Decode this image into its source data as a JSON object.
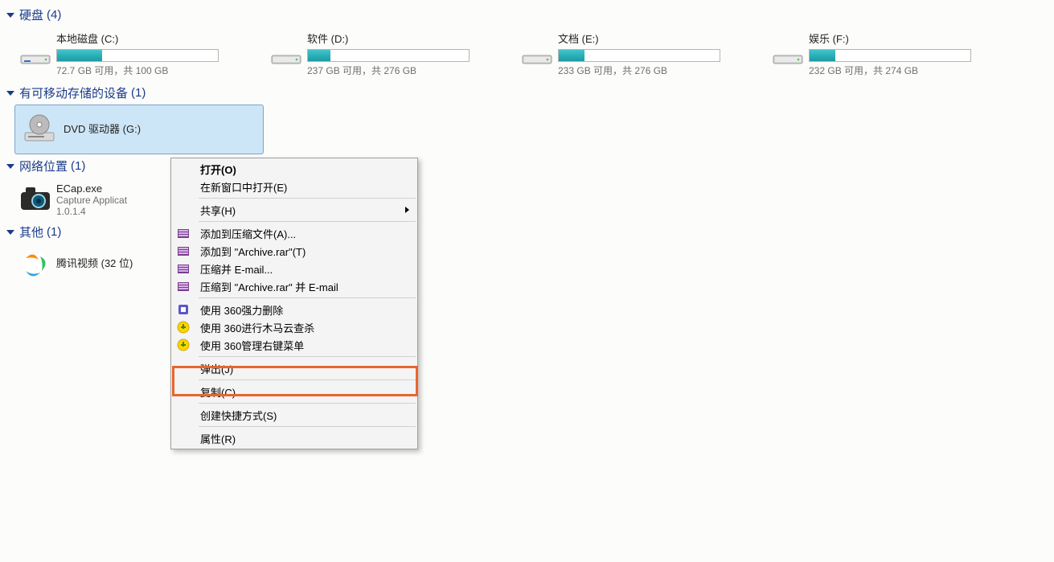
{
  "groups": {
    "hdd": {
      "title": "硬盘",
      "count": "(4)"
    },
    "removable": {
      "title": "有可移动存储的设备",
      "count": "(1)"
    },
    "network": {
      "title": "网络位置",
      "count": "(1)"
    },
    "other": {
      "title": "其他",
      "count": "(1)"
    }
  },
  "drives": [
    {
      "label": "本地磁盘 (C:)",
      "stats": "72.7 GB 可用，共 100 GB",
      "fillPct": 28
    },
    {
      "label": "软件 (D:)",
      "stats": "237 GB 可用，共 276 GB",
      "fillPct": 14
    },
    {
      "label": "文档 (E:)",
      "stats": "233 GB 可用，共 276 GB",
      "fillPct": 16
    },
    {
      "label": "娱乐 (F:)",
      "stats": "232 GB 可用，共 274 GB",
      "fillPct": 16
    }
  ],
  "dvd": {
    "label": "DVD 驱动器 (G:)"
  },
  "net": {
    "name": "ECap.exe",
    "sub1": "Capture Applicat",
    "sub2": "1.0.1.4"
  },
  "other": {
    "name": "腾讯视频 (32 位)"
  },
  "menu": {
    "open": "打开(O)",
    "openNew": "在新窗口中打开(E)",
    "share": "共享(H)",
    "rarAdd": "添加到压缩文件(A)...",
    "rarArc": "添加到 \"Archive.rar\"(T)",
    "rarMail": "压缩并 E-mail...",
    "rarArcMail": "压缩到 \"Archive.rar\" 并 E-mail",
    "del360": "使用 360强力删除",
    "scan360": "使用 360进行木马云查杀",
    "ctx360": "使用 360管理右键菜单",
    "eject": "弹出(J)",
    "copy": "复制(C)",
    "shortcut": "创建快捷方式(S)",
    "props": "属性(R)"
  }
}
